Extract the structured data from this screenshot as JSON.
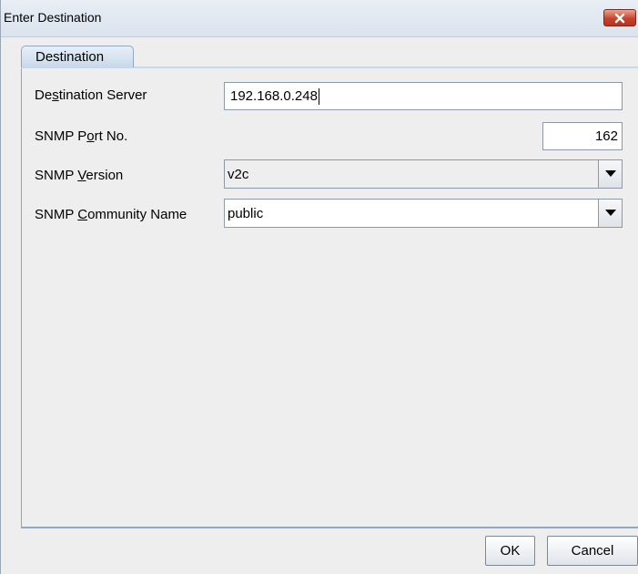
{
  "window": {
    "title": "Enter Destination"
  },
  "tabs": [
    {
      "label": "Destination",
      "selected": true
    }
  ],
  "form": {
    "destination_server": {
      "label_before": "De",
      "label_mnemonic": "s",
      "label_after": "tination Server",
      "value": "192.168.0.248"
    },
    "snmp_port": {
      "label_before": "SNMP P",
      "label_mnemonic": "o",
      "label_after": "rt No.",
      "value": "162"
    },
    "snmp_version": {
      "label_before": "SNMP ",
      "label_mnemonic": "V",
      "label_after": "ersion",
      "value": "v2c"
    },
    "snmp_community": {
      "label_before": "SNMP ",
      "label_mnemonic": "C",
      "label_after": "ommunity Name",
      "value": "public"
    }
  },
  "buttons": {
    "ok": "OK",
    "cancel": "Cancel"
  },
  "icons": {
    "close": "close-icon",
    "dropdown": "chevron-down-icon"
  },
  "colors": {
    "close_button": "#c8432d",
    "tab_fill": "#c8d8ea",
    "panel_border": "#8ea7c2"
  }
}
